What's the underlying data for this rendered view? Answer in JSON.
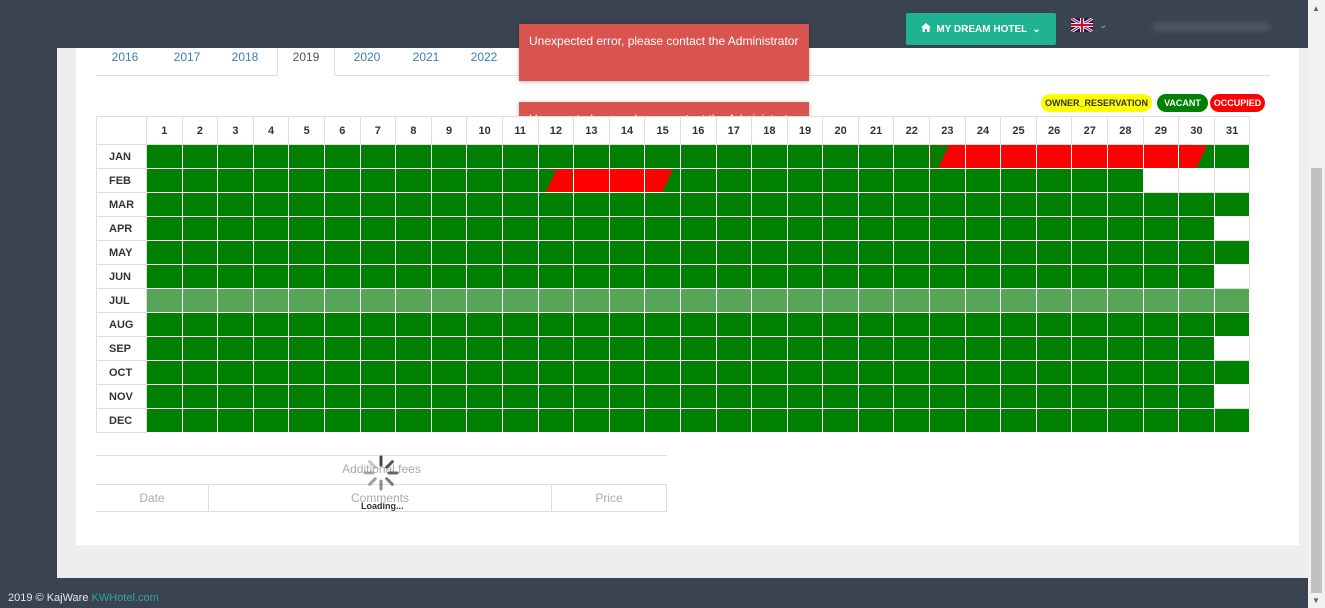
{
  "header": {
    "hotel_button_label": "MY DREAM HOTEL",
    "hotel_icon": "home-icon",
    "language_icon": "uk-flag-icon",
    "accent_color": "#1fb392"
  },
  "year_tabs": [
    "2016",
    "2017",
    "2018",
    "2019",
    "2020",
    "2021",
    "2022"
  ],
  "active_year": "2019",
  "toasts": [
    "Unexpected error, please contact the Administrator",
    "Unexpected error, please contact the Administrator"
  ],
  "legend": [
    {
      "label": "OWNER_RESERVATION",
      "color": "#ffff00",
      "text_color": "#333333"
    },
    {
      "label": "VACANT",
      "color": "#008000",
      "text_color": "#ffffff"
    },
    {
      "label": "OCCUPIED",
      "color": "#ff0000",
      "text_color": "#ffffff"
    }
  ],
  "calendar": {
    "days": [
      "1",
      "2",
      "3",
      "4",
      "5",
      "6",
      "7",
      "8",
      "9",
      "10",
      "11",
      "12",
      "13",
      "14",
      "15",
      "16",
      "17",
      "18",
      "19",
      "20",
      "21",
      "22",
      "23",
      "24",
      "25",
      "26",
      "27",
      "28",
      "29",
      "30",
      "31"
    ],
    "months": [
      {
        "name": "JAN",
        "days_in_month": 31,
        "occupied": [
          [
            23,
            30
          ]
        ]
      },
      {
        "name": "FEB",
        "days_in_month": 28,
        "occupied": [
          [
            12,
            15
          ]
        ]
      },
      {
        "name": "MAR",
        "days_in_month": 31,
        "occupied": []
      },
      {
        "name": "APR",
        "days_in_month": 30,
        "occupied": []
      },
      {
        "name": "MAY",
        "days_in_month": 31,
        "occupied": []
      },
      {
        "name": "JUN",
        "days_in_month": 30,
        "occupied": []
      },
      {
        "name": "JUL",
        "days_in_month": 31,
        "occupied": [],
        "highlighted": true
      },
      {
        "name": "AUG",
        "days_in_month": 31,
        "occupied": []
      },
      {
        "name": "SEP",
        "days_in_month": 30,
        "occupied": []
      },
      {
        "name": "OCT",
        "days_in_month": 31,
        "occupied": []
      },
      {
        "name": "NOV",
        "days_in_month": 30,
        "occupied": []
      },
      {
        "name": "DEC",
        "days_in_month": 31,
        "occupied": []
      }
    ],
    "vacant_color": "#008000",
    "occupied_color": "#ff0000"
  },
  "fees": {
    "title": "Additional fees",
    "columns": [
      "Date",
      "Comments",
      "Price"
    ],
    "loading_text": "Loading..."
  },
  "footer": {
    "copyright": "2019 © KajWare",
    "link": "KWHotel.com"
  }
}
